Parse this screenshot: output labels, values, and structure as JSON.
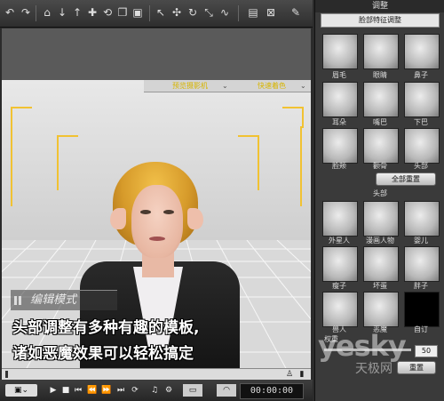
{
  "toolbar": {
    "icons": [
      "undo-icon",
      "redo-icon",
      "home-icon",
      "move-down-icon",
      "move-up-icon",
      "pan-icon",
      "rotate-icon",
      "copy-icon",
      "frame-icon",
      "select-icon",
      "translate-icon",
      "rotate-tool-icon",
      "scale-icon",
      "morph-icon",
      "image-icon",
      "close-frame-icon",
      "paint-icon"
    ]
  },
  "viewport": {
    "camera_label": "预览摄影机",
    "shading_label": "快速着色",
    "mode_label": "编辑模式",
    "caption_line1": "头部调整有多种有趣的模板,",
    "caption_line2": "诸如恶魔效果可以轻松搞定"
  },
  "transport": {
    "time": "00:00:00"
  },
  "panel": {
    "title": "调整",
    "feature_select": "脸部特征调整",
    "features": [
      "眉毛",
      "眼睛",
      "鼻子",
      "耳朵",
      "嘴巴",
      "下巴",
      "脸颊",
      "颧骨",
      "头部"
    ],
    "reset_all": "全部重置",
    "head_section": "头部",
    "head_presets": [
      "外星人",
      "漫画人物",
      "婴儿",
      "瘦子",
      "坏蛋",
      "胖子",
      "兽人",
      "恶魔",
      "自订"
    ],
    "weight_label": "权重",
    "weight_value": "50",
    "reset": "重置"
  },
  "watermark": {
    "brand": "yesky",
    "site": "天极网"
  },
  "colors": {
    "accent_yellow": "#f1c232",
    "panel_bg": "#3a3a3a"
  }
}
